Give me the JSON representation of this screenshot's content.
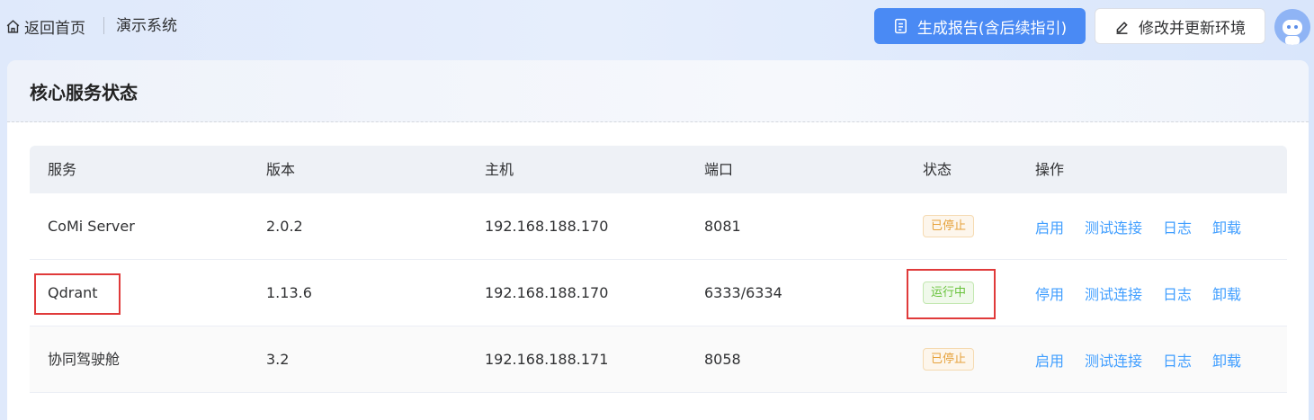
{
  "nav": {
    "back_label": "返回首页",
    "system_name": "演示系统"
  },
  "actions": {
    "generate_report_label": "生成报告(含后续指引)",
    "modify_env_label": "修改并更新环境"
  },
  "card": {
    "title": "核心服务状态"
  },
  "table": {
    "headers": [
      "服务",
      "版本",
      "主机",
      "端口",
      "状态",
      "操作"
    ],
    "rows": [
      {
        "service": "CoMi Server",
        "version": "2.0.2",
        "host": "192.168.188.170",
        "port": "8081",
        "status": "已停止",
        "status_type": "stopped",
        "ops": [
          "启用",
          "测试连接",
          "日志",
          "卸载"
        ]
      },
      {
        "service": "Qdrant",
        "version": "1.13.6",
        "host": "192.168.188.170",
        "port": "6333/6334",
        "status": "运行中",
        "status_type": "running",
        "ops": [
          "停用",
          "测试连接",
          "日志",
          "卸载"
        ]
      },
      {
        "service": "协同驾驶舱",
        "version": "3.2",
        "host": "192.168.188.171",
        "port": "8058",
        "status": "已停止",
        "status_type": "stopped",
        "ops": [
          "启用",
          "测试连接",
          "日志",
          "卸载"
        ]
      }
    ]
  },
  "colors": {
    "primary": "#4a8af4",
    "link": "#409eff",
    "stopped": "#e6a23c",
    "running": "#67c23a",
    "highlight": "#e03a3a"
  }
}
